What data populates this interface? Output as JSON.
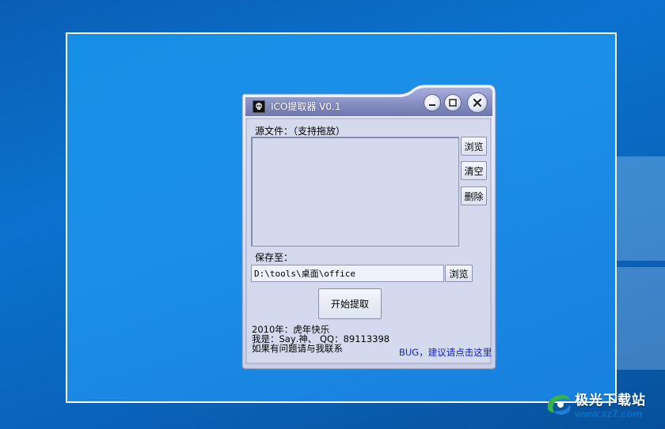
{
  "app": {
    "title": "ICO提取器 V0.1",
    "icon": "app-skull-icon"
  },
  "controls": {
    "minimize": "minimize-icon",
    "maximize": "maximize-icon",
    "close": "close-icon"
  },
  "source": {
    "label": "源文件：（支持拖放）",
    "browse_label": "浏览",
    "clear_label": "清空",
    "delete_label": "删除"
  },
  "save": {
    "label": "保存至：",
    "path_value": "D:\\tools\\桌面\\office",
    "browse_label": "浏览"
  },
  "start_label": "开始提取",
  "info": {
    "line1": "2010年：虎年快乐",
    "line2_prefix": "我是：",
    "line2_name": "Ѕaу.神、 QQ：89113398",
    "line3": "如果有问题请与我联系",
    "bug_link": "BUG，建议请点击这里"
  },
  "watermark": {
    "title": "极光下载站",
    "url": "www.xz7.com"
  },
  "colors": {
    "desktop": "#0b72cf",
    "window_body": "#d4daed",
    "title_bar": "#8f96c8",
    "link": "#1020c8"
  }
}
